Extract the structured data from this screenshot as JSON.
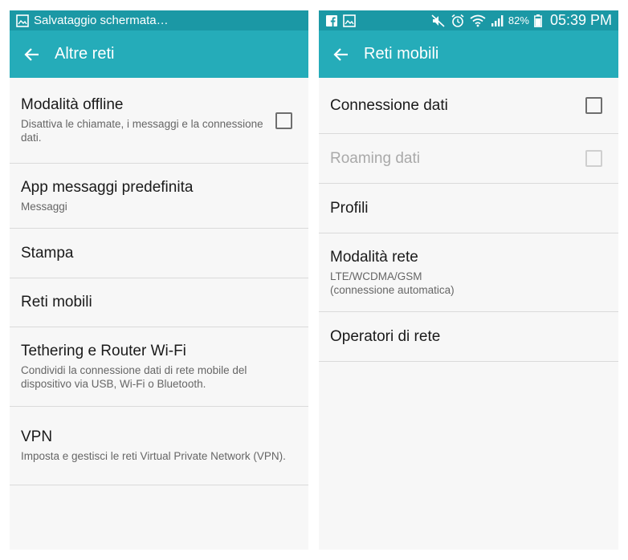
{
  "left": {
    "status": {
      "text": "Salvataggio schermata…"
    },
    "appbar": {
      "title": "Altre reti"
    },
    "items": [
      {
        "title": "Modalità offline",
        "subtitle": "Disattiva le chiamate, i messaggi e la connessione dati."
      },
      {
        "title": "App messaggi predefinita",
        "subtitle": "Messaggi"
      },
      {
        "title": "Stampa"
      },
      {
        "title": "Reti mobili"
      },
      {
        "title": "Tethering e Router Wi-Fi",
        "subtitle": "Condividi la connessione dati di rete mobile del dispositivo via USB, Wi-Fi o Bluetooth."
      },
      {
        "title": "VPN",
        "subtitle": "Imposta e gestisci le reti Virtual Private Network (VPN)."
      }
    ]
  },
  "right": {
    "status": {
      "battery": "82%",
      "time": "05:39 PM"
    },
    "appbar": {
      "title": "Reti mobili"
    },
    "items": [
      {
        "title": "Connessione dati"
      },
      {
        "title": "Roaming dati"
      },
      {
        "title": "Profili"
      },
      {
        "title": "Modalità rete",
        "subtitle": "LTE/WCDMA/GSM (connessione automatica)"
      },
      {
        "title": "Operatori di rete"
      }
    ]
  },
  "colors": {
    "status_bar": "#1b98a5",
    "app_bar": "#25acb9",
    "background": "#f7f7f7"
  }
}
